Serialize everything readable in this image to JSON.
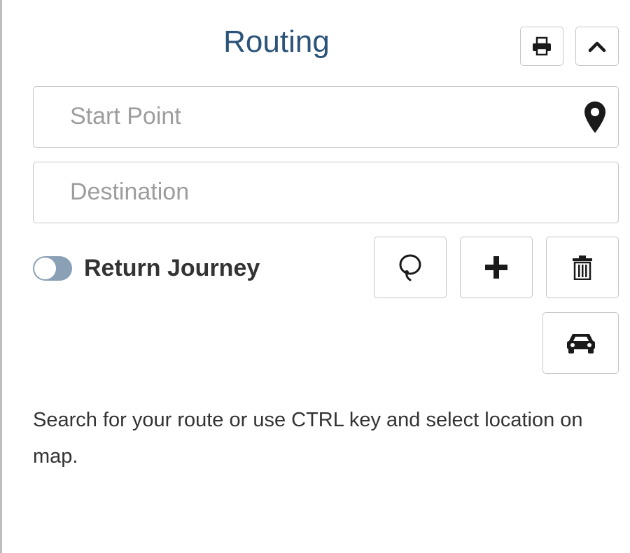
{
  "panel": {
    "title": "Routing",
    "header_buttons": [
      {
        "icon": "print-icon"
      },
      {
        "icon": "chevron-up-icon"
      }
    ]
  },
  "start": {
    "placeholder": "Start Point",
    "value": "",
    "icon": "map-marker-icon"
  },
  "destination": {
    "placeholder": "Destination",
    "value": ""
  },
  "return_journey": {
    "label": "Return Journey",
    "enabled": false
  },
  "actions": [
    {
      "icon": "lasso-icon"
    },
    {
      "icon": "plus-icon"
    },
    {
      "icon": "trash-icon"
    },
    {
      "icon": "car-icon"
    }
  ],
  "help_text": "Search for your route or use CTRL key and select location on map.",
  "colors": {
    "title": "#2c5379",
    "border": "#c6c6c6",
    "placeholder": "#9d9d9d",
    "toggle_track": "#8aa0b4",
    "icon": "#1a1a1a"
  }
}
